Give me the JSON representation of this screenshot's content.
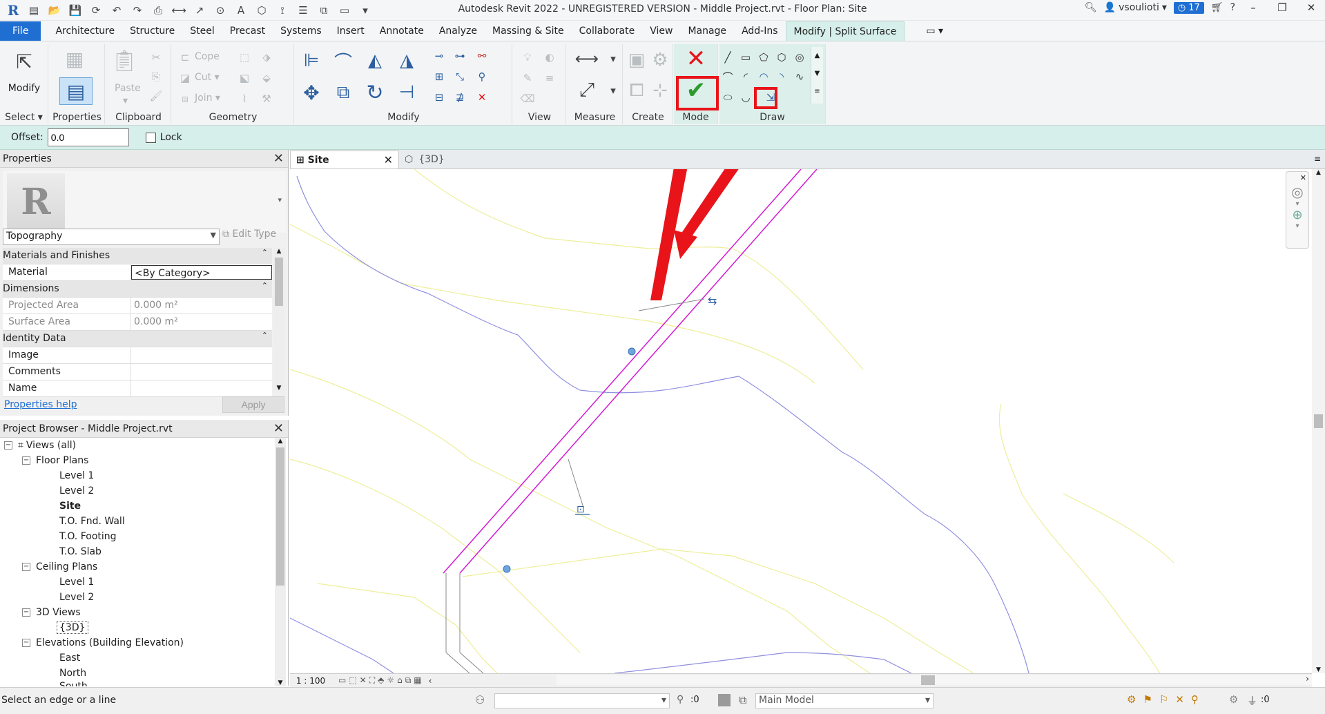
{
  "app": {
    "title": "Autodesk Revit 2022 - UNREGISTERED VERSION - Middle Project.rvt - Floor Plan: Site",
    "user": "vsoulioti",
    "notifications": "17"
  },
  "tabs": [
    "File",
    "Architecture",
    "Structure",
    "Steel",
    "Precast",
    "Systems",
    "Insert",
    "Annotate",
    "Analyze",
    "Massing & Site",
    "Collaborate",
    "View",
    "Manage",
    "Add-Ins",
    "Modify | Split Surface"
  ],
  "ribbon": {
    "panels": {
      "select": "Select",
      "properties": "Properties",
      "clipboard": "Clipboard",
      "geometry": "Geometry",
      "modify": "Modify",
      "view": "View",
      "measure": "Measure",
      "create": "Create",
      "mode": "Mode",
      "draw": "Draw"
    },
    "modify_label": "Modify",
    "paste_label": "Paste",
    "cope_label": "Cope",
    "cut_label": "Cut",
    "join_label": "Join"
  },
  "options": {
    "offset_label": "Offset:",
    "offset_value": "0.0",
    "lock_label": "Lock"
  },
  "properties": {
    "header": "Properties",
    "type": "Topography",
    "edit_type": "Edit Type",
    "sections": {
      "materials": "Materials and Finishes",
      "dimensions": "Dimensions",
      "identity": "Identity Data"
    },
    "rows": {
      "material_k": "Material",
      "material_v": "<By Category>",
      "projected_k": "Projected Area",
      "projected_v": "0.000 m²",
      "surface_k": "Surface Area",
      "surface_v": "0.000 m²",
      "image_k": "Image",
      "comments_k": "Comments",
      "name_k": "Name"
    },
    "help": "Properties help",
    "apply": "Apply"
  },
  "browser": {
    "header": "Project Browser - Middle Project.rvt",
    "views_all": "Views (all)",
    "floor_plans": "Floor Plans",
    "fp_level1": "Level 1",
    "fp_level2": "Level 2",
    "fp_site": "Site",
    "fp_fnd": "T.O. Fnd. Wall",
    "fp_footing": "T.O. Footing",
    "fp_slab": "T.O. Slab",
    "ceiling_plans": "Ceiling Plans",
    "cp_level1": "Level 1",
    "cp_level2": "Level 2",
    "views3d": "3D Views",
    "v3d": "{3D}",
    "elevations": "Elevations (Building Elevation)",
    "east": "East",
    "north": "North",
    "south": "South"
  },
  "view_tabs": {
    "site": "Site",
    "threed": "{3D}"
  },
  "view_controls": {
    "scale": "1 : 100"
  },
  "status": {
    "prompt": "Select an edge or a line",
    "worksets": ":0",
    "model": "Main Model",
    "filter_count": ":0"
  },
  "colors": {
    "accent": "#1f6fd3",
    "contextual_tab": "#d6efea",
    "highlight_red": "#e8141a",
    "line_magenta": "#d21ad2",
    "contour_yellow": "#eeee99",
    "contour_blue": "#8f8fe0"
  }
}
